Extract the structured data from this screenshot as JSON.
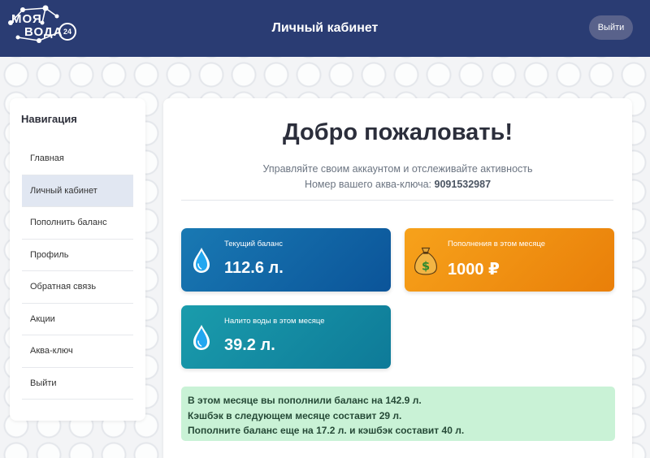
{
  "header": {
    "logo_line1": "МОЯ",
    "logo_line2": "ВОДА",
    "logo_badge": "24",
    "title": "Личный кабинет",
    "logout_label": "Выйти"
  },
  "sidebar": {
    "title": "Навигация",
    "items": [
      {
        "label": "Главная",
        "active": false
      },
      {
        "label": "Личный кабинет",
        "active": true
      },
      {
        "label": "Пополнить баланс",
        "active": false
      },
      {
        "label": "Профиль",
        "active": false
      },
      {
        "label": "Обратная связь",
        "active": false
      },
      {
        "label": "Акции",
        "active": false
      },
      {
        "label": "Аква-ключ",
        "active": false
      },
      {
        "label": "Выйти",
        "active": false
      }
    ]
  },
  "main": {
    "welcome": "Добро пожаловать!",
    "subtitle": "Управляйте своим аккаунтом и отслеживайте активность",
    "key_label": "Номер вашего аква-ключа:",
    "key_value": "9091532987",
    "cards": [
      {
        "label": "Текущий баланс",
        "value": "112.6 л.",
        "icon": "water-drop-icon",
        "color": "#1274b0"
      },
      {
        "label": "Пополнения в этом месяце",
        "value": "1000 ₽",
        "icon": "money-bag-icon",
        "color": "#f29414"
      },
      {
        "label": "Налито воды в этом месяце",
        "value": "39.2 л.",
        "icon": "water-drop-icon",
        "color": "#1594a8"
      }
    ],
    "info": {
      "line1_prefix": "В этом месяце вы пополнили баланс на ",
      "line1_value": "142.9 л.",
      "line2_prefix": "Кэшбэк в следующем месяце составит ",
      "line2_value": "29 л.",
      "line3_prefix": "Пополните баланс еще на ",
      "line3_value1": "17.2 л.",
      "line3_mid": " и кэшбэк составит ",
      "line3_value2": "40 л."
    }
  }
}
